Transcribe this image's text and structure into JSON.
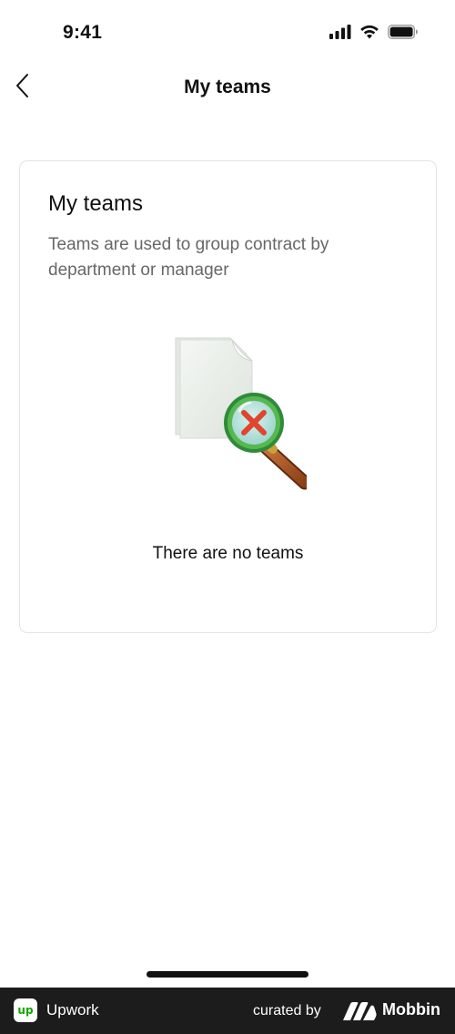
{
  "status_bar": {
    "time": "9:41",
    "icons": [
      "signal-icon",
      "wifi-icon",
      "battery-icon"
    ]
  },
  "nav": {
    "back_icon": "chevron-left-icon",
    "title": "My teams"
  },
  "card": {
    "title": "My teams",
    "description": "Teams are used to group contract by department or manager",
    "empty_illustration": "document-search-no-results-icon",
    "empty_message": "There are no teams"
  },
  "footer": {
    "app_logo_text": "up",
    "app_name": "Upwork",
    "curated_label": "curated by",
    "curator_name": "Mobbin"
  },
  "colors": {
    "background": "#ffffff",
    "card_border": "#e3e3e3",
    "description_text": "#676767",
    "footer_background": "#1c1c1c",
    "brand_green": "#14a800"
  }
}
